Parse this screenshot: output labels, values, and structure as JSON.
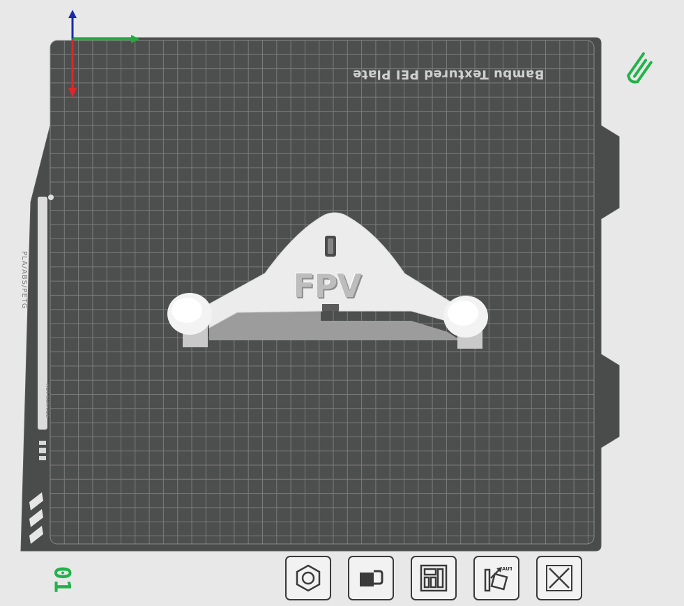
{
  "plate": {
    "label": "Bambu Textured PEI Plate",
    "number": "01",
    "filament_label": "PLA/ABS/PETG",
    "hot_surface_label": "HOT SURFACE"
  },
  "model": {
    "text": "FPV"
  },
  "toolbar": {
    "items": [
      {
        "name": "orient-button",
        "icon": "hexagon-nut-icon"
      },
      {
        "name": "lock-button",
        "icon": "lock-icon"
      },
      {
        "name": "arrange-button",
        "icon": "arrange-icon"
      },
      {
        "name": "auto-orient-button",
        "icon": "auto-orient-icon",
        "badge": "AUTO"
      },
      {
        "name": "close-button",
        "icon": "close-icon"
      }
    ]
  },
  "colors": {
    "background": "#e8e8e9",
    "plate": "#4a4b4b",
    "grid": "#8a8b8b",
    "accent_green": "#22b34a",
    "axis_x": "#e0262b",
    "axis_y": "#1fae3a",
    "axis_z": "#1a2aa8"
  }
}
